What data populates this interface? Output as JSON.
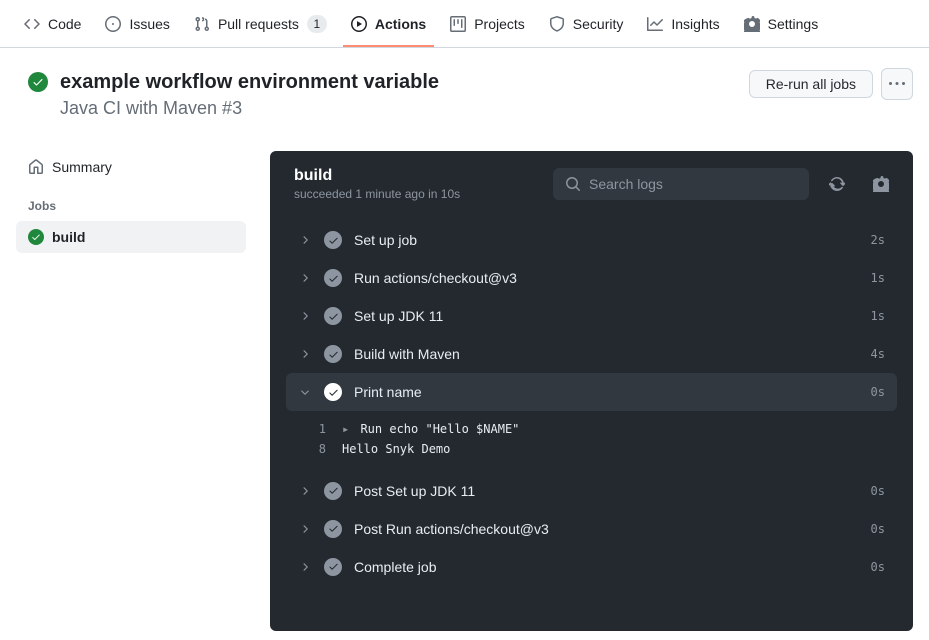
{
  "tabs": {
    "code": "Code",
    "issues": "Issues",
    "pull_requests": "Pull requests",
    "pr_count": "1",
    "actions": "Actions",
    "projects": "Projects",
    "security": "Security",
    "insights": "Insights",
    "settings": "Settings"
  },
  "header": {
    "title": "example workflow environment variable",
    "subtitle": "Java CI with Maven #3",
    "rerun_label": "Re-run all jobs"
  },
  "sidebar": {
    "summary": "Summary",
    "jobs_label": "Jobs",
    "job_build": "build"
  },
  "job": {
    "title": "build",
    "subtitle": "succeeded 1 minute ago in 10s",
    "search_placeholder": "Search logs"
  },
  "steps": [
    {
      "name": "Set up job",
      "time": "2s",
      "expanded": false
    },
    {
      "name": "Run actions/checkout@v3",
      "time": "1s",
      "expanded": false
    },
    {
      "name": "Set up JDK 11",
      "time": "1s",
      "expanded": false
    },
    {
      "name": "Build with Maven",
      "time": "4s",
      "expanded": false
    },
    {
      "name": "Print name",
      "time": "0s",
      "expanded": true,
      "log": [
        {
          "num": "1",
          "caret": true,
          "text": "Run echo \"Hello $NAME\""
        },
        {
          "num": "8",
          "caret": false,
          "text": "Hello Snyk Demo"
        }
      ]
    },
    {
      "name": "Post Set up JDK 11",
      "time": "0s",
      "expanded": false
    },
    {
      "name": "Post Run actions/checkout@v3",
      "time": "0s",
      "expanded": false
    },
    {
      "name": "Complete job",
      "time": "0s",
      "expanded": false
    }
  ]
}
